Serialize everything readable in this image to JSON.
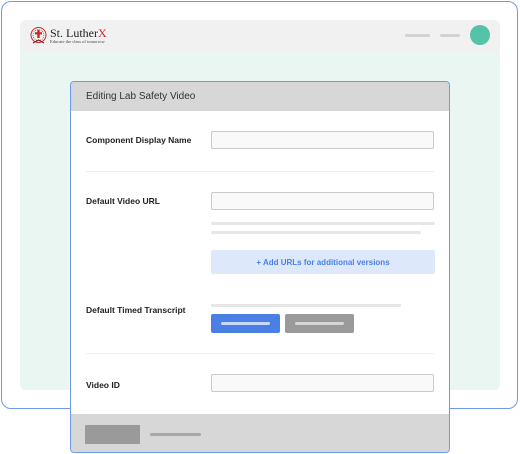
{
  "brand": {
    "name_main": "St. Luther",
    "name_x": "X",
    "tagline": "Educate the class of tomorrow"
  },
  "modal": {
    "title": "Editing Lab Safety Video",
    "fields": {
      "display_name": {
        "label": "Component Display Name",
        "value": ""
      },
      "video_url": {
        "label": "Default Video URL",
        "value": ""
      },
      "timed_transcript": {
        "label": "Default Timed Transcript"
      },
      "video_id": {
        "label": "Video ID",
        "value": ""
      }
    },
    "add_urls_label": "+ Add URLs for additional versions"
  },
  "colors": {
    "accent": "#4a80e6",
    "frame_border": "#6f98f0",
    "app_background": "#eaf6f2",
    "avatar": "#55c3a8",
    "brand_x": "#c62828"
  },
  "icons": {
    "logo": "crest-icon"
  }
}
